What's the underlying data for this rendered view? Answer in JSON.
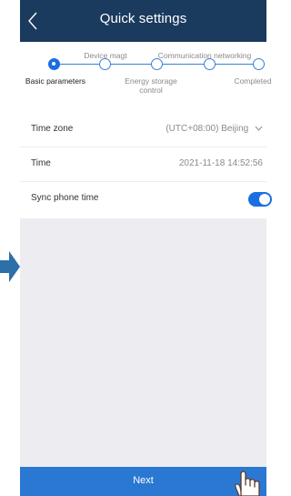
{
  "header": {
    "title": "Quick settings"
  },
  "stepper": {
    "steps": [
      {
        "label": "Basic parameters",
        "state": "active"
      },
      {
        "label": "Device magt",
        "state": "pending"
      },
      {
        "label": "Energy storage control",
        "state": "pending"
      },
      {
        "label": "Communication networking",
        "state": "pending"
      },
      {
        "label": "Completed",
        "state": "pending"
      }
    ]
  },
  "settings": {
    "time_zone": {
      "label": "Time zone",
      "value": "(UTC+08:00) Beijing"
    },
    "time": {
      "label": "Time",
      "value": "2021-11-18 14:52:56"
    },
    "sync_phone_time": {
      "label": "Sync phone time",
      "enabled": true
    }
  },
  "footer": {
    "next_label": "Next"
  },
  "colors": {
    "header_bg": "#1a3a5e",
    "accent": "#1a6fe0",
    "next_bar": "#2a78d2",
    "content_bg": "#ececf1"
  },
  "icons": [
    "back-arrow-icon",
    "chevron-down-icon",
    "pointing-hand-icon",
    "right-arrow-icon"
  ]
}
